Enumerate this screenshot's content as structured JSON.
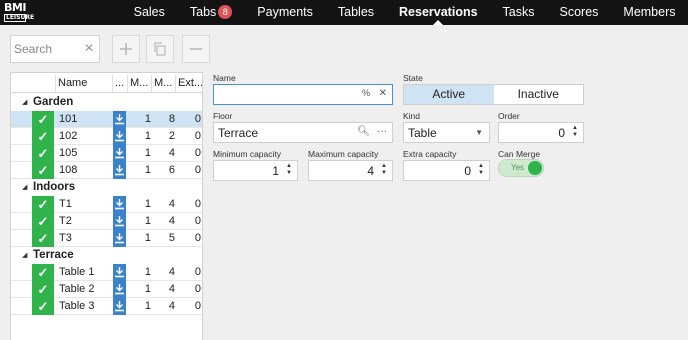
{
  "app": {
    "logo_top": "BMI",
    "logo_bottom": "LEISURE"
  },
  "nav": [
    {
      "label": "Sales"
    },
    {
      "label": "Tabs",
      "badge": "8"
    },
    {
      "label": "Payments"
    },
    {
      "label": "Tables"
    },
    {
      "label": "Reservations",
      "active": true
    },
    {
      "label": "Tasks"
    },
    {
      "label": "Scores"
    },
    {
      "label": "Members"
    }
  ],
  "search": {
    "placeholder": "Search",
    "value": ""
  },
  "toolbar": {
    "add_icon": "plus-icon",
    "copy_icon": "copy-icon",
    "remove_icon": "minus-icon"
  },
  "grid": {
    "columns": [
      "Name",
      "...",
      "M...",
      "M...",
      "Ext..."
    ],
    "groups": [
      {
        "name": "Garden",
        "rows": [
          {
            "name": "101",
            "min": "1",
            "max": "8",
            "extra": "0",
            "selected": true
          },
          {
            "name": "102",
            "min": "1",
            "max": "2",
            "extra": "0"
          },
          {
            "name": "105",
            "min": "1",
            "max": "4",
            "extra": "0"
          },
          {
            "name": "108",
            "min": "1",
            "max": "6",
            "extra": "0"
          }
        ]
      },
      {
        "name": "Indoors",
        "rows": [
          {
            "name": "T1",
            "min": "1",
            "max": "4",
            "extra": "0"
          },
          {
            "name": "T2",
            "min": "1",
            "max": "4",
            "extra": "0"
          },
          {
            "name": "T3",
            "min": "1",
            "max": "5",
            "extra": "0"
          }
        ]
      },
      {
        "name": "Terrace",
        "rows": [
          {
            "name": "Table 1",
            "min": "1",
            "max": "4",
            "extra": "0"
          },
          {
            "name": "Table 2",
            "min": "1",
            "max": "4",
            "extra": "0"
          },
          {
            "name": "Table 3",
            "min": "1",
            "max": "4",
            "extra": "0"
          }
        ]
      }
    ]
  },
  "form": {
    "name_label": "Name",
    "name_value": "",
    "state_label": "State",
    "state_options": [
      "Active",
      "Inactive"
    ],
    "state_selected": "Active",
    "floor_label": "Floor",
    "floor_value": "Terrace",
    "kind_label": "Kind",
    "kind_value": "Table",
    "order_label": "Order",
    "order_value": "0",
    "min_capacity_label": "Minimum capacity",
    "min_capacity_value": "1",
    "max_capacity_label": "Maximum capacity",
    "max_capacity_value": "4",
    "extra_capacity_label": "Extra capacity",
    "extra_capacity_value": "0",
    "can_merge_label": "Can Merge",
    "can_merge_value": "Yes"
  },
  "colors": {
    "topbar": "#141414",
    "accent_green": "#2fb34a",
    "selection_blue": "#cfe3f5",
    "download_blue": "#3b82c9",
    "badge_red": "#e05353"
  }
}
